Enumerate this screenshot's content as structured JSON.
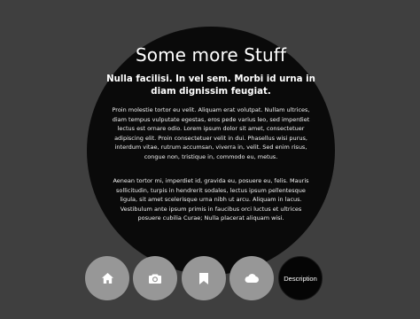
{
  "content": {
    "title": "Some more Stuff",
    "subtitle": "Nulla facilisi. In vel sem. Morbi id urna in diam dignissim feugiat.",
    "paragraphs": [
      "Proin molestie tortor eu velit. Aliquam erat volutpat. Nullam ultrices, diam tempus vulputate egestas, eros pede varius leo, sed imperdiet lectus est ornare odio. Lorem ipsum dolor sit amet, consectetuer adipiscing elit. Proin consectetuer velit in dui. Phasellus wisi purus, interdum vitae, rutrum accumsan, viverra in, velit. Sed enim risus, congue non, tristique in, commodo eu, metus.",
      "Aenean tortor mi, imperdiet id, gravida eu, posuere eu, felis. Mauris sollicitudin, turpis in hendrerit sodales, lectus ipsum pellentesque ligula, sit amet scelerisque urna nibh ut arcu. Aliquam in lacus. Vestibulum ante ipsum primis in faucibus orci luctus et ultrices posuere cubilia Curae; Nulla placerat aliquam wisi."
    ]
  },
  "nav": {
    "buttons": [
      {
        "icon": "home-icon"
      },
      {
        "icon": "camera-icon"
      },
      {
        "icon": "bookmark-icon"
      },
      {
        "icon": "cloud-icon"
      },
      {
        "label": "Description"
      }
    ]
  },
  "colors": {
    "background": "#3f3f3f",
    "circle": "#0a0a0a",
    "button": "#979797",
    "active_button": "#050505",
    "text": "#ffffff"
  }
}
